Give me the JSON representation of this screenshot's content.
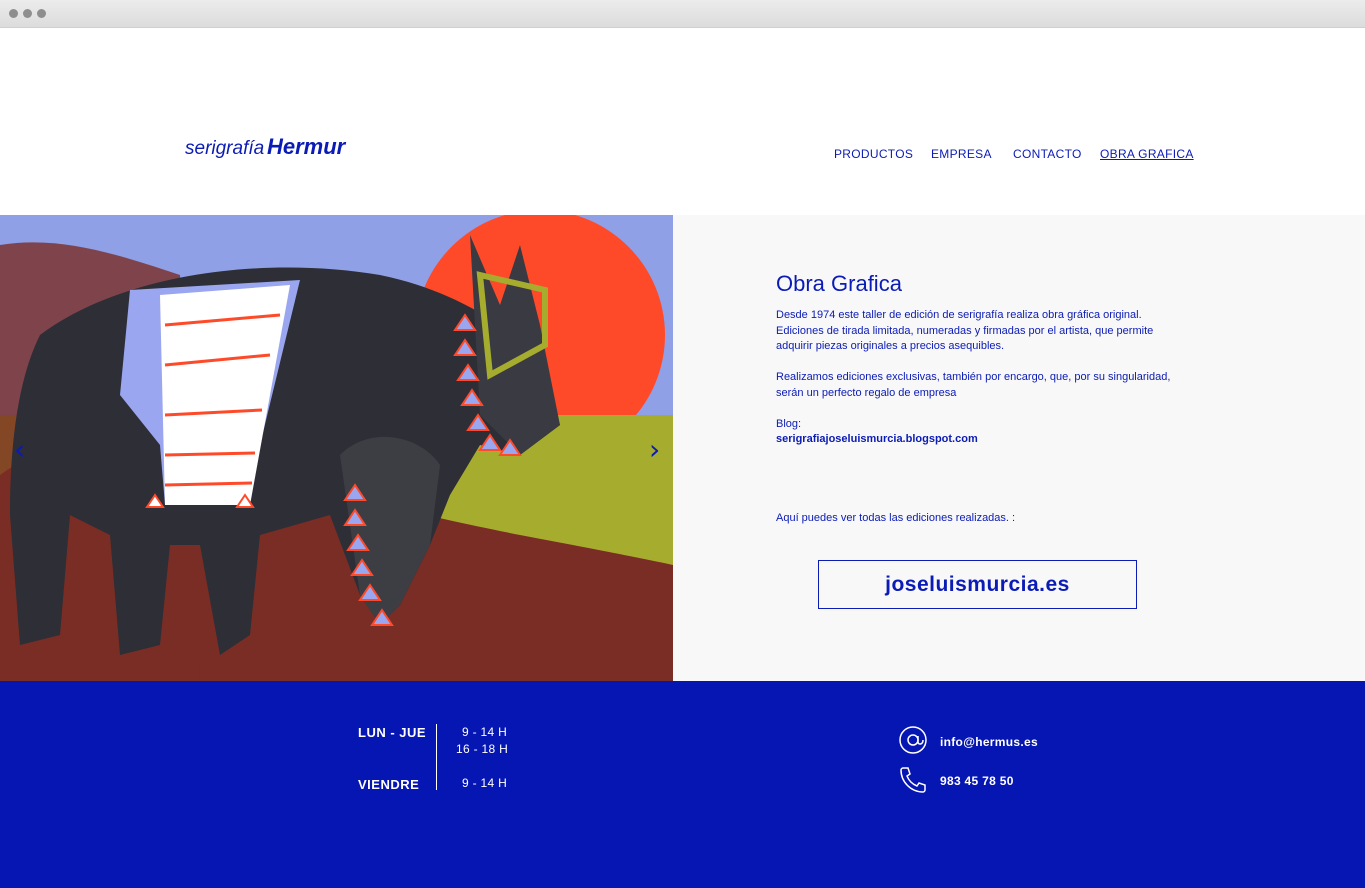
{
  "logo": {
    "text_left": "serigrafía",
    "text_right": "Hermur"
  },
  "nav": {
    "items": [
      "PRODUCTOS",
      "EMPRESA",
      "CONTACTO",
      "OBRA GRAFICA"
    ]
  },
  "slider": {
    "prev_label": "‹",
    "next_label": "›"
  },
  "panel": {
    "title": "Obra Grafica",
    "paragraph1": "Desde 1974 este taller de edición de serigrafía realiza obra gráfica original. Ediciones de tirada limitada, numeradas y firmadas por el artista, que permite adquirir piezas originales a precios asequibles.",
    "paragraph2": "Realizamos ediciones  exclusivas, también por encargo, que, por su singularidad, serán un perfecto regalo de empresa",
    "blog_label": "Blog:",
    "blog_link": "serigrafiajoseluismurcia.blogspot.com",
    "editions_text": "Aquí puedes ver todas las ediciones realizadas. :",
    "button_label": "joseluismurcia.es"
  },
  "footer": {
    "hours": [
      {
        "day": "LUN - JUE",
        "times": [
          "9 - 14 H",
          "16 - 18 H"
        ]
      },
      {
        "day": "VIENDRE",
        "times": [
          "9 - 14 H"
        ]
      }
    ],
    "email": "info@hermus.es",
    "phone": "983 45 78 50"
  },
  "colors": {
    "brand_blue": "#0616b2",
    "text_blue": "#0b1bb5",
    "panel_bg": "#f8f8f8"
  }
}
